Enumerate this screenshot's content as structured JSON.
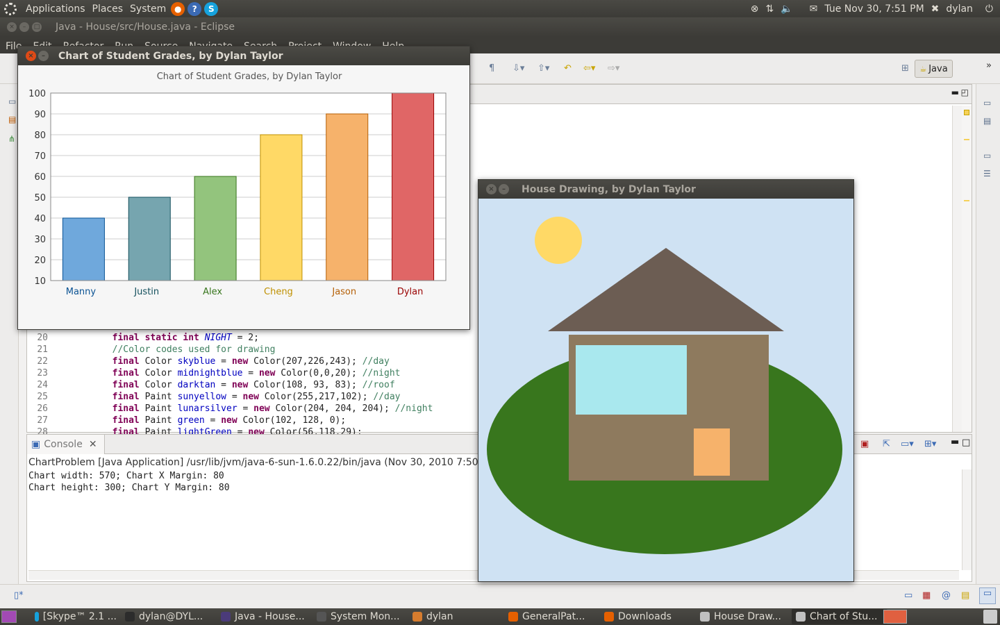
{
  "top_panel": {
    "menus": [
      "Applications",
      "Places",
      "System"
    ],
    "clock": "Tue Nov 30,  7:51 PM",
    "user": "dylan"
  },
  "eclipse": {
    "title": "Java - House/src/House.java - Eclipse",
    "menus": [
      "File",
      "Edit",
      "Refactor",
      "Run",
      "Source",
      "Navigate",
      "Search",
      "Project",
      "Window",
      "Help"
    ],
    "perspective": "Java",
    "code_lines": [
      {
        "n": "20",
        "parts": [
          [
            "",
            "        "
          ],
          [
            "kw",
            "final static int "
          ],
          [
            "fld ital",
            "NIGHT"
          ],
          [
            "",
            " = 2;"
          ]
        ]
      },
      {
        "n": "21",
        "parts": [
          [
            "",
            "        "
          ],
          [
            "cmt",
            "//Color codes used for drawing"
          ]
        ]
      },
      {
        "n": "22",
        "parts": [
          [
            "",
            "        "
          ],
          [
            "kw",
            "final"
          ],
          [
            "",
            " Color "
          ],
          [
            "fld",
            "skyblue"
          ],
          [
            "",
            " = "
          ],
          [
            "kw",
            "new"
          ],
          [
            "",
            " Color(207,226,243); "
          ],
          [
            "cmt",
            "//day"
          ]
        ]
      },
      {
        "n": "23",
        "parts": [
          [
            "",
            "        "
          ],
          [
            "kw",
            "final"
          ],
          [
            "",
            " Color "
          ],
          [
            "fld",
            "midnightblue"
          ],
          [
            "",
            " = "
          ],
          [
            "kw",
            "new"
          ],
          [
            "",
            " Color(0,0,20); "
          ],
          [
            "cmt",
            "//night"
          ]
        ]
      },
      {
        "n": "24",
        "parts": [
          [
            "",
            "        "
          ],
          [
            "kw",
            "final"
          ],
          [
            "",
            " Color "
          ],
          [
            "fld",
            "darktan"
          ],
          [
            "",
            " = "
          ],
          [
            "kw",
            "new"
          ],
          [
            "",
            " Color(108, 93, 83); "
          ],
          [
            "cmt",
            "//roof"
          ]
        ]
      },
      {
        "n": "25",
        "parts": [
          [
            "",
            "        "
          ],
          [
            "kw",
            "final"
          ],
          [
            "",
            " Paint "
          ],
          [
            "fld",
            "sunyellow"
          ],
          [
            "",
            " = "
          ],
          [
            "kw",
            "new"
          ],
          [
            "",
            " Color(255,217,102); "
          ],
          [
            "cmt",
            "//day"
          ]
        ]
      },
      {
        "n": "26",
        "parts": [
          [
            "",
            "        "
          ],
          [
            "kw",
            "final"
          ],
          [
            "",
            " Paint "
          ],
          [
            "fld",
            "lunarsilver"
          ],
          [
            "",
            " = "
          ],
          [
            "kw",
            "new"
          ],
          [
            "",
            " Color(204, 204, 204); "
          ],
          [
            "cmt",
            "//night"
          ]
        ]
      },
      {
        "n": "27",
        "parts": [
          [
            "",
            "        "
          ],
          [
            "kw",
            "final"
          ],
          [
            "",
            " Paint "
          ],
          [
            "fld",
            "green"
          ],
          [
            "",
            " = "
          ],
          [
            "kw",
            "new"
          ],
          [
            "",
            " Color(102, 128, 0);"
          ]
        ]
      },
      {
        "n": "28",
        "parts": [
          [
            "",
            "        "
          ],
          [
            "kw",
            "final"
          ],
          [
            "",
            " Paint "
          ],
          [
            "fld",
            "lightGreen"
          ],
          [
            "",
            " = "
          ],
          [
            "kw",
            "new"
          ],
          [
            "",
            " Color(56,118,29);"
          ]
        ]
      }
    ],
    "console": {
      "tab_label": "Console",
      "description": "ChartProblem [Java Application] /usr/lib/jvm/java-6-sun-1.6.0.22/bin/java (Nov 30, 2010 7:50:52 PM)",
      "lines": [
        "Chart width: 570; Chart X Margin: 80",
        "Chart height: 300; Chart Y Margin: 80"
      ]
    }
  },
  "chart_window": {
    "title": "Chart of Student Grades, by Dylan Taylor"
  },
  "chart_data": {
    "type": "bar",
    "title": "Chart of Student Grades, by Dylan Taylor",
    "categories": [
      "Manny",
      "Justin",
      "Alex",
      "Cheng",
      "Jason",
      "Dylan"
    ],
    "values": [
      40,
      50,
      60,
      80,
      90,
      100
    ],
    "colors": [
      "#6fa8dc",
      "#76a5af",
      "#93c47d",
      "#ffd966",
      "#f6b26b",
      "#e06666"
    ],
    "label_colors": [
      "#0b5394",
      "#134f5c",
      "#38761d",
      "#bf9000",
      "#b45f06",
      "#990000"
    ],
    "yticks": [
      10,
      20,
      30,
      40,
      50,
      60,
      70,
      80,
      90,
      100
    ],
    "ylim": [
      10,
      100
    ],
    "grid": true,
    "xlabel": "",
    "ylabel": ""
  },
  "house_window": {
    "title": "House Drawing, by Dylan Taylor",
    "colors": {
      "sky": "#cfe2f3",
      "sun": "#ffd966",
      "roof": "#6c5d53",
      "walls": "#8e7a5e",
      "window": "#a9e8ee",
      "door": "#f6b26b",
      "ground": "#38761d"
    }
  },
  "taskbar": {
    "tasks": [
      {
        "label": "[Skype™ 2.1 ...",
        "icon": "skype-icon",
        "color": "#16a2dd"
      },
      {
        "label": "dylan@DYL...",
        "icon": "terminal-icon",
        "color": "#2c2c2c"
      },
      {
        "label": "Java - House...",
        "icon": "eclipse-icon",
        "color": "#4b3b7a"
      },
      {
        "label": "System Mon...",
        "icon": "system-monitor-icon",
        "color": "#555"
      },
      {
        "label": "dylan",
        "icon": "folder-icon",
        "color": "#d67c2e"
      },
      {
        "label": "GeneralPat...",
        "icon": "firefox-icon",
        "color": "#e66000"
      },
      {
        "label": "Downloads",
        "icon": "firefox-icon",
        "color": "#e66000"
      },
      {
        "label": "House Draw...",
        "icon": "java-icon",
        "color": "#c0c0c0"
      },
      {
        "label": "Chart of Stu...",
        "icon": "java-icon",
        "color": "#c0c0c0"
      }
    ]
  }
}
